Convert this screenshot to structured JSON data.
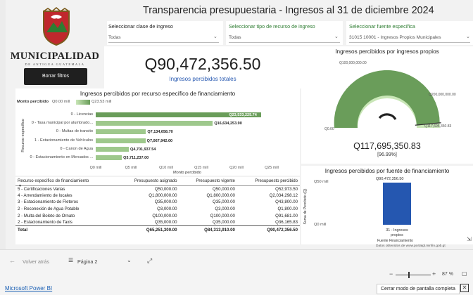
{
  "header": {
    "title": "Transparencia presupuestaria - Ingresos al 31 de diciembre 2024"
  },
  "logo": {
    "name": "MUNICIPALIDAD",
    "sub": "DE ANTIGUA GUATEMALA"
  },
  "buttons": {
    "clear_filters": "Borrar filtros"
  },
  "filters": [
    {
      "label": "Seleccionar clase de ingreso",
      "value": "Todas"
    },
    {
      "label": "Seleccionar tipo de recurso de ingreso",
      "value": "Todas"
    },
    {
      "label": "Seleccionar fuente específica",
      "value": "31015 10001 - Ingresos Propios Municipales"
    }
  ],
  "kpi": {
    "value": "Q90,472,356.50",
    "label": "Ingresos percibidos totales"
  },
  "colors": {
    "primary": "#6a9d5a",
    "secondary": "#9ec88c",
    "gauge_track": "#c9e6b7",
    "accent_blue": "#2557b0",
    "text_dark": "#1f1f1f"
  },
  "chart_data": [
    {
      "type": "bar",
      "orientation": "horizontal",
      "title": "Ingresos percibidos por recurso específico de financiamiento",
      "legend": {
        "title": "Monto percibido",
        "min": "Q0.00 mill",
        "max": "Q23.53 mill"
      },
      "ylabel": "Recurso específico",
      "xlabel": "Monto percibido",
      "categories": [
        "0 - Licencias",
        "0 - Tasa municipal por alumbrado...",
        "0 - Multas de transito",
        "1 - Estacionamiento de Vehículos",
        "0 - Canon de Agua",
        "0 - Estacionamiento en Mercados ..."
      ],
      "values": [
        23533225.74,
        16634253.9,
        7134658.7,
        7067942.0,
        4701937.54,
        3711237.0
      ],
      "value_labels": [
        "Q23,533,225.74",
        "Q16,634,253.90",
        "Q7,134,658.70",
        "Q7,067,942.00",
        "Q4,701,937.54",
        "Q3,711,237.00"
      ],
      "x_ticks": [
        "Q0 mill",
        "Q5 mill",
        "Q10 mill",
        "Q15 mill",
        "Q20 mill",
        "Q25 mill"
      ],
      "xlim": [
        0,
        25000000
      ]
    },
    {
      "type": "gauge",
      "title": "Ingresos percibidos por ingresos propios",
      "value": 117695350.83,
      "value_label": "Q117,695,350.83",
      "percent_label": "[96.99%]",
      "target": 117695350.83,
      "min": 0,
      "max": 121345000,
      "labels": {
        "min": "Q0.00",
        "mid": "Q100,000,000.00",
        "max": "Q200,000,000.00",
        "target": "Q117,695,350.83"
      }
    },
    {
      "type": "bar",
      "title": "Ingresos percibidos por fuente de financiamiento",
      "categories": [
        "31 - Ingresos propios"
      ],
      "values": [
        90472356.5
      ],
      "value_labels": [
        "Q90,472,356.50"
      ],
      "y_ticks": [
        "Q50 mill",
        "Q0 mill"
      ],
      "ylabel": "Suma de Percibido (Q)",
      "xlabel": "Fuente Financiamiento",
      "ylim": [
        0,
        100000000
      ],
      "note": "Datos obtenidos de www.portalgl.minfin.gob.gt"
    }
  ],
  "table": {
    "headers": [
      "Recurso específico de financiamiento",
      "Presupuesto asignado",
      "Presupuesto vigente",
      "Presupuesto percibido"
    ],
    "rows": [
      [
        "5 - Certificaciones Varias",
        "Q50,000.00",
        "Q50,000.00",
        "Q52,973.50"
      ],
      [
        "4 - Arrendamiento de locales",
        "Q1,800,000.00",
        "Q1,800,000.00",
        "Q2,034,298.12"
      ],
      [
        "3 - Estacionamiento de Fleteros",
        "Q35,000.00",
        "Q35,000.00",
        "Q43,800.00"
      ],
      [
        "2 - Reconexión de Agua Potable",
        "Q3,000.00",
        "Q3,000.00",
        "Q1,800.00"
      ],
      [
        "2 - Multa del Boleto de Ornato",
        "Q100,000.00",
        "Q100,000.00",
        "Q91,681.00"
      ],
      [
        "2 - Estacionamiento de Taxis",
        "Q35,000.00",
        "Q35,000.00",
        "Q36,165.83"
      ]
    ],
    "total": [
      "Total",
      "Q65,251,300.00",
      "Q84,313,910.00",
      "Q90,472,356.50"
    ]
  },
  "footer": {
    "back": "Volver atrás",
    "page": "Página 2",
    "zoom_minus": "−",
    "zoom_plus": "+",
    "zoom": "87 %",
    "powerbi": "Microsoft Power BI",
    "exit_fullscreen": "Cerrar modo de pantalla completa"
  }
}
